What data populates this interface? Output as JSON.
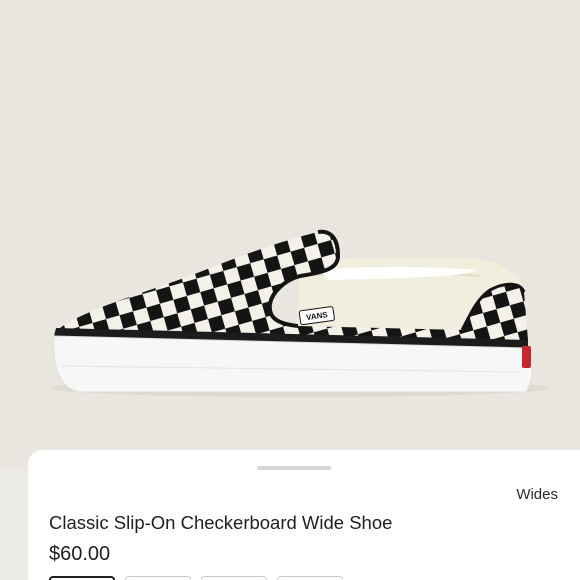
{
  "product": {
    "category": "Wides",
    "title": "Classic Slip-On Checkerboard Wide Shoe",
    "price": "$60.00"
  },
  "image": {
    "subject": "shoe-image",
    "logo_text": "VANS",
    "background_color": "#e9e6df"
  },
  "colors": {
    "check_dark": "#141414",
    "check_light": "#f3f1e8",
    "canvas_cream": "#f2eedd",
    "sole": "#f7f7f7",
    "foxing_stripe": "#1c1c1c",
    "heel_tab": "#c8272d"
  },
  "options": {
    "chip_count": 4,
    "selected_index": 0
  }
}
